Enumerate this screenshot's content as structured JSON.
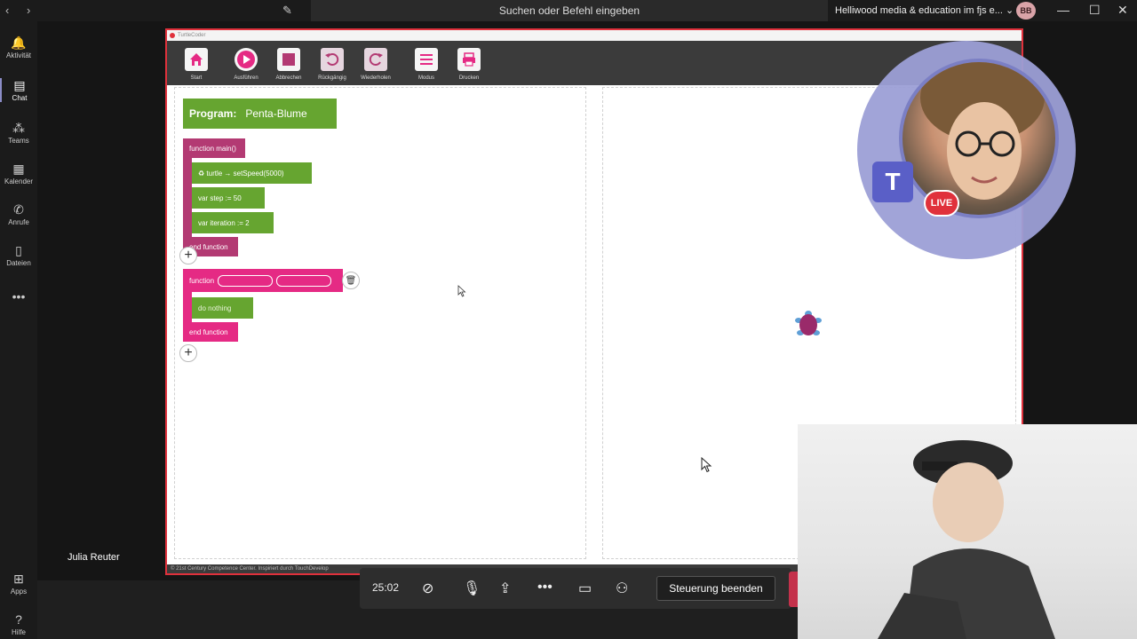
{
  "titlebar": {
    "back": "‹",
    "forward": "›",
    "search_placeholder": "Suchen oder Befehl eingeben",
    "org": "Helliwood media & education im fjs e... ⌄",
    "avatar_initials": "BB",
    "minimize": "—",
    "maximize": "☐",
    "close": "✕"
  },
  "rail": {
    "items": [
      {
        "label": "Aktivität",
        "icon": "🔔"
      },
      {
        "label": "Chat",
        "icon": "▤"
      },
      {
        "label": "Teams",
        "icon": "⁂"
      },
      {
        "label": "Kalender",
        "icon": "▦"
      },
      {
        "label": "Anrufe",
        "icon": "✆"
      },
      {
        "label": "Dateien",
        "icon": "▯"
      },
      {
        "label": "•••",
        "icon": ""
      },
      {
        "label": "Apps",
        "icon": "⊞"
      },
      {
        "label": "Hilfe",
        "icon": "?"
      }
    ]
  },
  "app": {
    "window_title": "TurtleCoder",
    "toolbar": [
      {
        "label": "Start",
        "icon": "home-icon"
      },
      {
        "label": "Ausführen",
        "icon": "play-icon"
      },
      {
        "label": "Abbrechen",
        "icon": "stop-icon"
      },
      {
        "label": "Rückgängig",
        "icon": "undo-icon"
      },
      {
        "label": "Wiederholen",
        "icon": "redo-icon"
      },
      {
        "label": "Modus",
        "icon": "list-icon"
      },
      {
        "label": "Drucken",
        "icon": "print-icon"
      }
    ],
    "program_label": "Program:",
    "program_name": "Penta-Blume",
    "main_func": "function main()",
    "stmt_speed": "♻ turtle → setSpeed(5000)",
    "stmt_step": "var step := 50",
    "stmt_iter": "var iteration := 2",
    "end_function": "end function",
    "new_func": "function",
    "do_nothing": "do nothing",
    "footer": "© 21st Century Competence Center. Inspiriert durch TouchDevelop"
  },
  "meeting": {
    "presenter": "Julia Reuter",
    "timer": "25:02",
    "stop_control": "Steuerung beenden",
    "live": "LIVE"
  },
  "colors": {
    "green": "#66a530",
    "purple": "#b33a73",
    "pink": "#e52a84",
    "accent_red": "#e0313c"
  }
}
